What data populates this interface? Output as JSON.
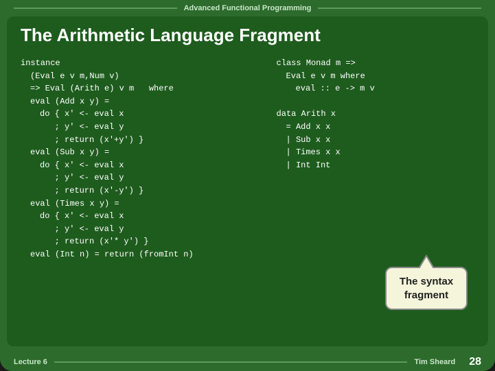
{
  "topbar": {
    "label": "Advanced Functional Programming"
  },
  "title": "The Arithmetic Language Fragment",
  "left_code": [
    "instance",
    "  (Eval e v m,Num v)",
    "  => Eval (Arith e) v m   where",
    "  eval (Add x y) =",
    "    do { x' <- eval x",
    "       ; y' <- eval y",
    "       ; return (x'+y') }",
    "  eval (Sub x y) =",
    "    do { x' <- eval x",
    "       ; y' <- eval y",
    "       ; return (x'-y') }",
    "  eval (Times x y) =",
    "    do { x' <- eval x",
    "       ; y' <- eval y",
    "       ; return (x'* y') }",
    "  eval (Int n) = return (fromInt n)"
  ],
  "right_code": [
    "class Monad m =>",
    "  Eval e v m where",
    "    eval :: e -> m v",
    "",
    "data Arith x",
    "  = Add x x",
    "  | Sub x x",
    "  | Times x x",
    "  | Int Int"
  ],
  "callout": {
    "text": "The syntax fragment"
  },
  "bottom": {
    "left": "Lecture 6",
    "right": "Tim Sheard",
    "page": "28"
  }
}
